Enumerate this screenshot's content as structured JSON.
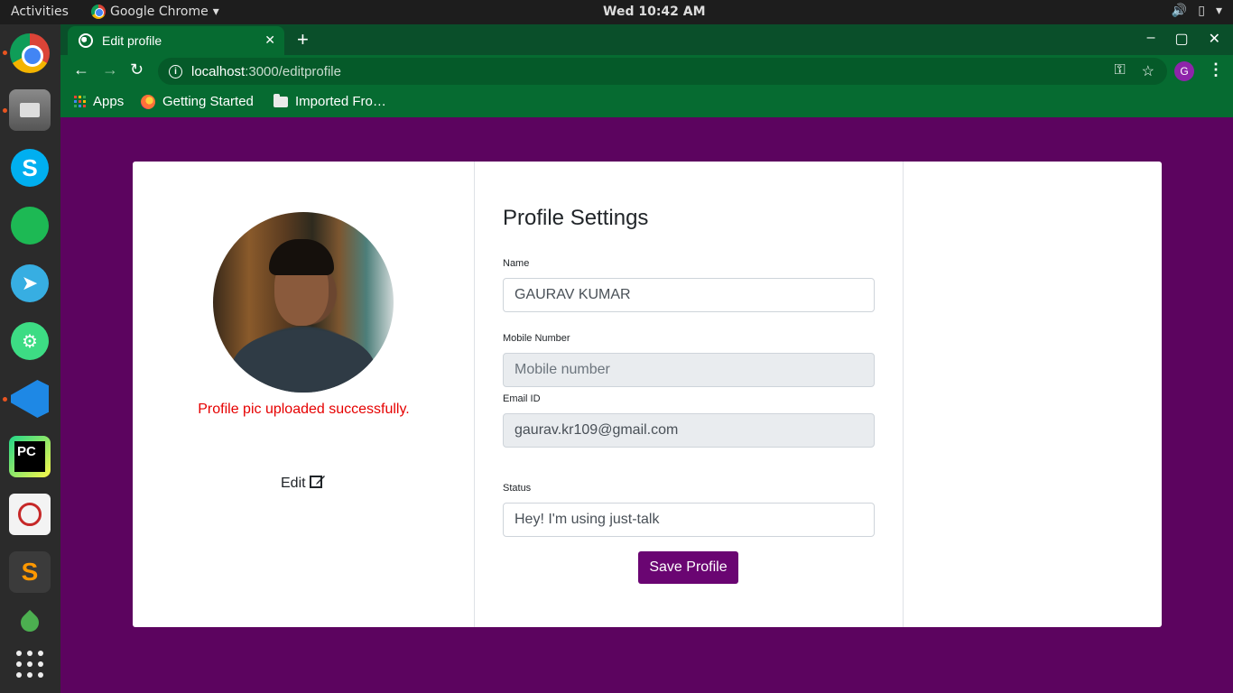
{
  "topbar": {
    "activities": "Activities",
    "app_name": "Google Chrome",
    "app_menu_arrow": "▾",
    "clock": "Wed 10:42 AM",
    "tray_icons": [
      "volume-icon",
      "battery-icon",
      "system-menu-icon"
    ]
  },
  "dock": {
    "apps": [
      "chrome",
      "files",
      "skype",
      "spotify",
      "telegram",
      "android-studio",
      "vscode",
      "pycharm",
      "document-viewer",
      "sublime-text",
      "drop-app",
      "show-applications"
    ],
    "skype_letter": "S",
    "pycharm_text": "PC",
    "sublime_letter": "S"
  },
  "browser": {
    "tab_title": "Edit profile",
    "tab_close": "✕",
    "new_tab": "+",
    "window_controls": [
      "–",
      "▢",
      "✕"
    ],
    "url_host": "localhost",
    "url_path": ":3000/editprofile",
    "profile_initial": "G",
    "bookmarks": [
      "Apps",
      "Getting Started",
      "Imported Fro…"
    ]
  },
  "profile": {
    "upload_message": "Profile pic uploaded successfully.",
    "edit_label": "Edit",
    "settings_title": "Profile Settings",
    "name_label": "Name",
    "name_value": "GAURAV KUMAR",
    "mobile_label": "Mobile Number",
    "mobile_placeholder": "Mobile number",
    "email_label": "Email ID",
    "email_value": "gaurav.kr109@gmail.com",
    "status_label": "Status",
    "status_value": "Hey! I'm using just-talk",
    "save_label": "Save Profile"
  },
  "colors": {
    "page_bg": "#5c045f",
    "browser_theme": "#066b31",
    "button": "#6a0572",
    "success_text": "#e60000"
  }
}
